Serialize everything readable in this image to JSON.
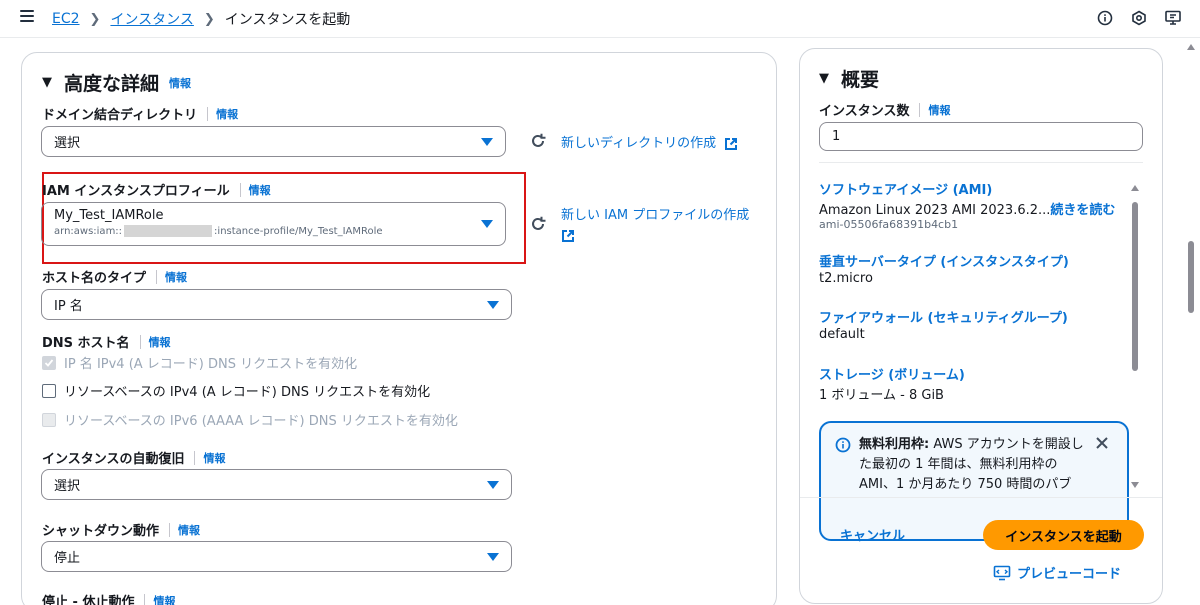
{
  "breadcrumb": {
    "items": [
      "EC2",
      "インスタンス"
    ],
    "current": "インスタンスを起動"
  },
  "info_label": "情報",
  "advanced": {
    "title": "高度な詳細",
    "domain_dir": {
      "label": "ドメイン結合ディレクトリ",
      "value": "選択",
      "create_link": "新しいディレクトリの作成"
    },
    "iam": {
      "label": "IAM インスタンスプロフィール",
      "name": "My_Test_IAMRole",
      "arn_prefix": "arn:aws:iam::",
      "arn_suffix": ":instance-profile/My_Test_IAMRole",
      "create_link": "新しい IAM プロファイルの作成"
    },
    "hostname": {
      "label": "ホスト名のタイプ",
      "value": "IP 名"
    },
    "dns": {
      "label": "DNS ホスト名",
      "options": [
        "IP 名 IPv4 (A レコード) DNS リクエストを有効化",
        "リソースベースの IPv4 (A レコード) DNS リクエストを有効化",
        "リソースベースの IPv6 (AAAA レコード) DNS リクエストを有効化"
      ]
    },
    "recovery": {
      "label": "インスタンスの自動復旧",
      "value": "選択"
    },
    "shutdown": {
      "label": "シャットダウン動作",
      "value": "停止"
    },
    "stop_hibernate": {
      "label": "停止 - 休止動作"
    }
  },
  "summary": {
    "title": "概要",
    "count_label": "インスタンス数",
    "count_value": "1",
    "ami_head": "ソフトウェアイメージ (AMI)",
    "ami_value": "Amazon Linux 2023 AMI 2023.6.2...",
    "ami_readmore": "続きを読む",
    "ami_id": "ami-05506fa68391b4cb1",
    "type_head": "垂直サーバータイプ (インスタンスタイプ)",
    "type_value": "t2.micro",
    "fw_head": "ファイアウォール (セキュリティグループ)",
    "fw_value": "default",
    "storage_head": "ストレージ (ボリューム)",
    "storage_value": "1 ボリューム - 8 GiB",
    "free_tier_bold": "無料利用枠:",
    "free_tier_text": " AWS アカウントを開設した最初の 1 年間は、無料利用枠の AMI、1 か月あたり 750 時間のパブ",
    "cancel": "キャンセル",
    "launch": "インスタンスを起動",
    "preview": "プレビューコード"
  },
  "colors": {
    "link": "#0972d3",
    "primary_button": "#ff9900",
    "highlight_border": "#d91515"
  }
}
